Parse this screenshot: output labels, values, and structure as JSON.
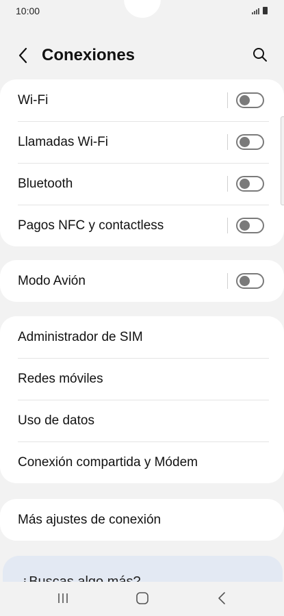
{
  "status_bar": {
    "time": "10:00"
  },
  "header": {
    "title": "Conexiones"
  },
  "groups": [
    {
      "items": [
        {
          "label": "Wi-Fi",
          "toggle": "off"
        },
        {
          "label": "Llamadas Wi-Fi",
          "toggle": "off"
        },
        {
          "label": "Bluetooth",
          "toggle": "off"
        },
        {
          "label": "Pagos NFC y contactless",
          "toggle": "off"
        }
      ]
    },
    {
      "items": [
        {
          "label": "Modo Avión",
          "toggle": "off"
        }
      ]
    },
    {
      "items": [
        {
          "label": "Administrador de SIM"
        },
        {
          "label": "Redes móviles"
        },
        {
          "label": "Uso de datos"
        },
        {
          "label": "Conexión compartida y Módem"
        }
      ]
    },
    {
      "items": [
        {
          "label": "Más ajustes de conexión"
        }
      ]
    }
  ],
  "suggestion": {
    "text": "¿Buscas algo más?"
  },
  "colors": {
    "background": "#f2f2f2",
    "card": "#ffffff",
    "suggestion_bg": "#e3e9f3",
    "toggle_off": "#7a7a7a"
  },
  "icons": [
    "back-arrow-icon",
    "search-icon",
    "signal-icon",
    "battery-icon",
    "recent-apps-icon",
    "home-icon",
    "back-nav-icon"
  ]
}
